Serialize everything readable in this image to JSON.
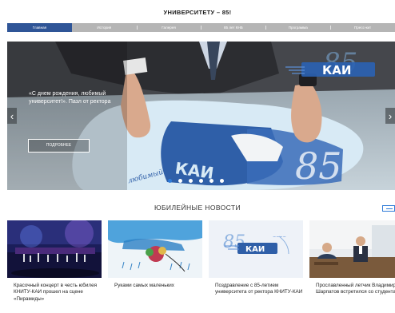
{
  "site": {
    "title": "УНИВЕРСИТЕТУ – 85!"
  },
  "nav": {
    "items": [
      {
        "label": "Главная",
        "active": true
      },
      {
        "label": "История"
      },
      {
        "label": "Галерея"
      },
      {
        "label": "85 лет КНБ"
      },
      {
        "label": "Программа"
      },
      {
        "label": "Пресс-кит"
      }
    ]
  },
  "hero": {
    "quote": "«С днем рождения, любимый университет!». Пазл от ректора",
    "button_label": "ПОДРОБНЕЕ",
    "logo_text": "КАИ",
    "logo_number": "85",
    "slide_count": 6,
    "active_slide": 1
  },
  "news": {
    "heading": "ЮБИЛЕЙНЫЕ НОВОСТИ",
    "items": [
      {
        "title": "Красочный концерт в честь юбилея КНИТУ-КАИ прошел на сцене «Пирамиды»"
      },
      {
        "title": "Руками самых маленьких"
      },
      {
        "title": "Поздравление с 85-летием университета от ректора КНИТУ-КАИ",
        "logo_text": "КАИ",
        "logo_number": "85"
      },
      {
        "title": "Прославленный летчик Владимир Шарпатов встретился со студентами"
      }
    ]
  },
  "colors": {
    "accent": "#2f5597",
    "nav_bg": "#b5b5b5",
    "dot_active": "#2f7bd8"
  },
  "icons": [
    "chevron-left-icon",
    "chevron-right-icon"
  ]
}
